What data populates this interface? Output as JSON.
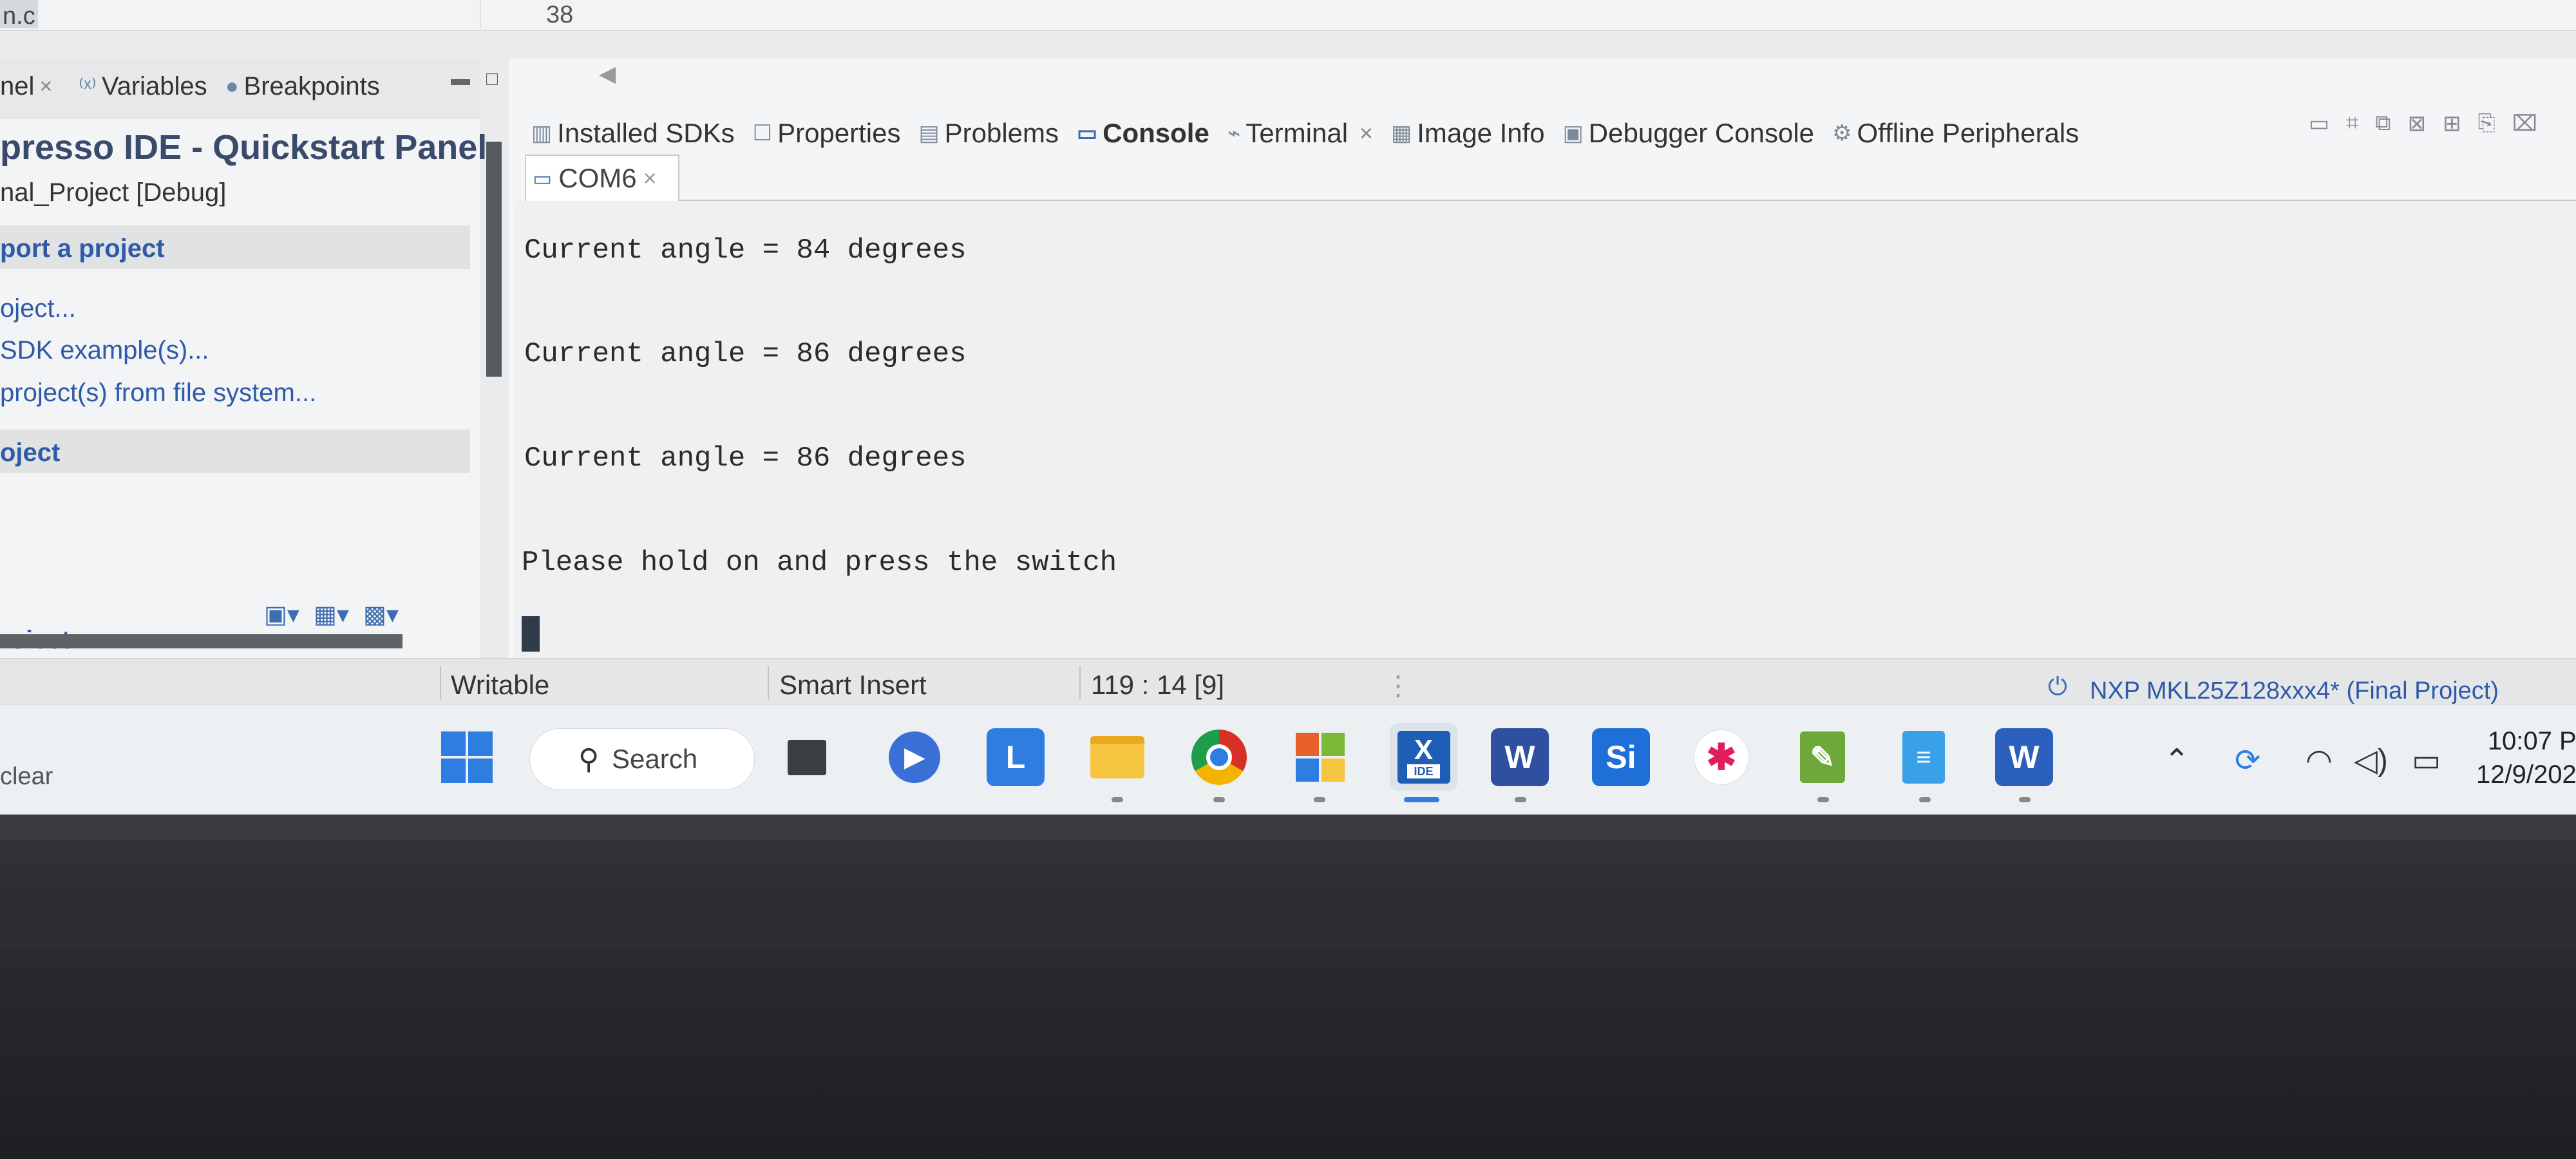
{
  "editor": {
    "file_name": "n.c",
    "line_number": "38"
  },
  "left_panel": {
    "tabs": [
      {
        "label": "nel",
        "icon": "close-icon",
        "closable": true
      },
      {
        "label": "Variables",
        "icon": "variables-icon"
      },
      {
        "label": "Breakpoints",
        "icon": "breakpoints-icon"
      }
    ],
    "title": "presso IDE - Quickstart Panel",
    "subtitle": "nal_Project [Debug]",
    "section_import": "port a project",
    "links": [
      "oject...",
      "SDK example(s)...",
      "project(s) from file system..."
    ],
    "section_project": "oject",
    "bottom_label": "roiect",
    "tool_icons": [
      "ls-icon",
      "image-icon",
      "save-icon"
    ]
  },
  "view_tabs": [
    {
      "label": "Installed SDKs",
      "icon": "sdk-icon"
    },
    {
      "label": "Properties",
      "icon": "properties-icon"
    },
    {
      "label": "Problems",
      "icon": "problems-icon"
    },
    {
      "label": "Console",
      "icon": "console-icon",
      "active": true
    },
    {
      "label": "Terminal",
      "icon": "terminal-icon",
      "closable": true
    },
    {
      "label": "Image Info",
      "icon": "image-info-icon"
    },
    {
      "label": "Debugger Console",
      "icon": "debugger-console-icon"
    },
    {
      "label": "Offline Peripherals",
      "icon": "peripherals-icon"
    }
  ],
  "terminal": {
    "tab_label": "COM6",
    "lines": [
      "Current angle = 84 degrees",
      "Current angle = 86 degrees",
      "Current angle = 86 degrees",
      "Please hold on and press the switch"
    ]
  },
  "status_bar": {
    "mode": "Writable",
    "insert": "Smart Insert",
    "position": "119 : 14 [9]",
    "device": "NXP MKL25Z128xxx4* (Final Project)"
  },
  "taskbar": {
    "left_text": "clear",
    "search_label": "Search",
    "apps": [
      "windows-start-icon",
      "task-view-icon",
      "zoom-icon",
      "l-app-icon",
      "file-explorer-icon",
      "chrome-icon",
      "office-icon",
      "mcuxpresso-ide-icon",
      "wps-icon",
      "si-app-icon",
      "slack-icon",
      "editor-icon",
      "notepad-icon",
      "word-icon"
    ],
    "ide_badge": "IDE",
    "tray_icons": [
      "chevron-up-icon",
      "sync-icon",
      "wifi-icon",
      "volume-icon",
      "battery-icon"
    ],
    "time": "10:07 P",
    "date": "12/9/202"
  },
  "colors": {
    "link": "#2e5aa8",
    "title": "#3a4a6a",
    "taskbar": "#edf0f2",
    "screen": "#e9ebec"
  }
}
